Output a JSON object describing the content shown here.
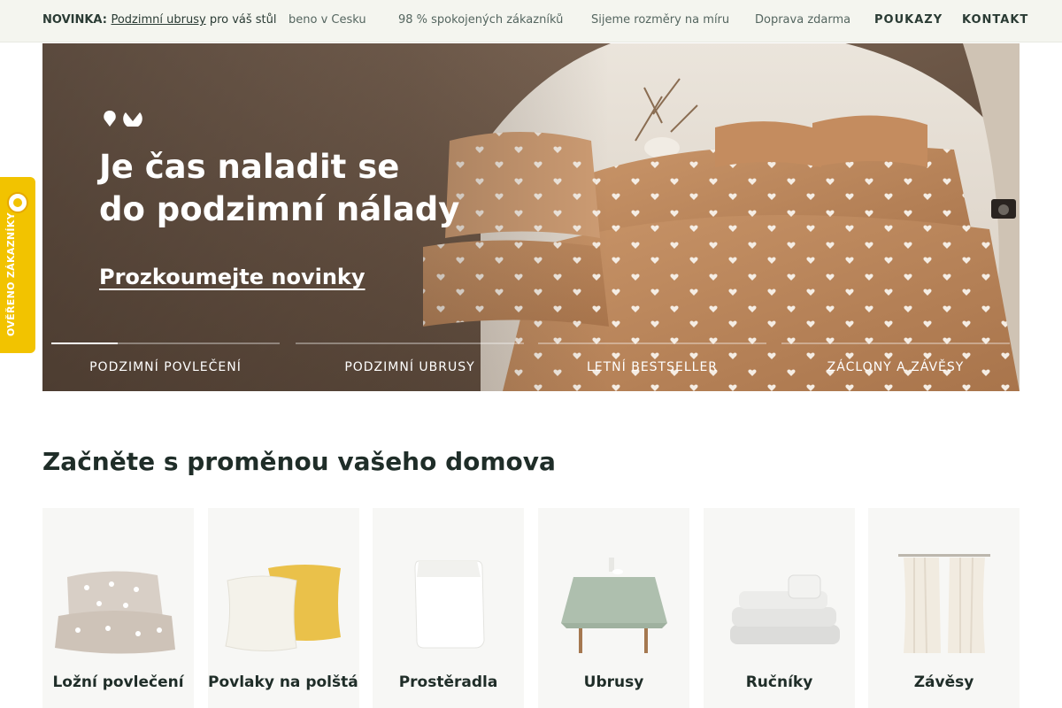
{
  "topbar": {
    "novinka_lead": "NOVINKA: ",
    "novinka_link": "Podzimní ubrusy",
    "novinka_tail": " pro váš stůl",
    "ticker": [
      "beno v Česku",
      "98 % spokojených zákazníků",
      "Šijeme rozměry na míru",
      "Doprava zdarma"
    ],
    "nav": [
      "POUKAZY",
      "KONTAKT"
    ]
  },
  "hero": {
    "title_line1": "Je čas naladit se",
    "title_line2": "do podzimní nálady",
    "cta": "Prozkoumejte novinky",
    "tabs": [
      {
        "label": "PODZIMNÍ POVLEČENÍ",
        "progress": 0.29
      },
      {
        "label": "PODZIMNÍ UBRUSY",
        "progress": 0
      },
      {
        "label": "LETNÍ BESTSELLER",
        "progress": 0
      },
      {
        "label": "ZÁCLONY A ZÁVĚSY",
        "progress": 0
      }
    ]
  },
  "side_badge": {
    "label": "OVĚŘENO ZÁKAZNÍKY"
  },
  "section": {
    "title_light": "Začněte s proměnou ",
    "title_bold": "vašeho domova"
  },
  "categories": [
    {
      "name": "Ložní povlečení",
      "icon": "bedding-icon"
    },
    {
      "name": "Povlaky na polštáře",
      "icon": "pillowcase-icon"
    },
    {
      "name": "Prostěradla",
      "icon": "bedsheet-icon"
    },
    {
      "name": "Ubrusy",
      "icon": "tablecloth-icon"
    },
    {
      "name": "Ručníky",
      "icon": "towels-icon"
    },
    {
      "name": "Závěsy",
      "icon": "curtains-icon"
    }
  ],
  "colors": {
    "topbar_bg": "#f4f5ef",
    "hero_bed": "#c08a5e",
    "badge_yellow": "#f2c300",
    "text_dark": "#1f2d28"
  }
}
